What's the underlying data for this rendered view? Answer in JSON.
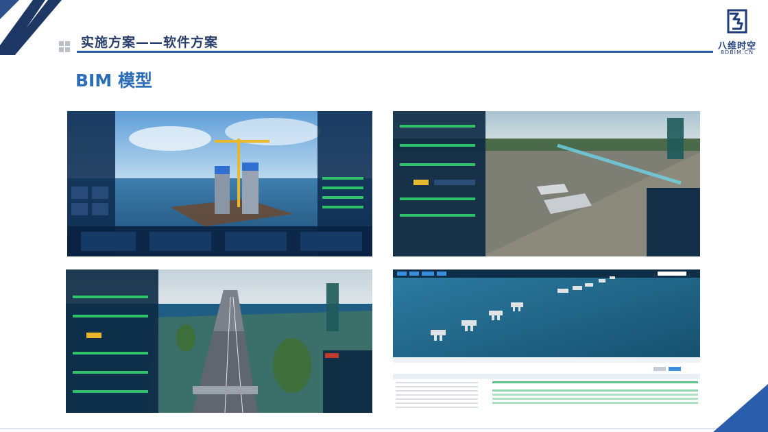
{
  "header": {
    "section_title": "实施方案——软件方案",
    "page_subtitle": "BIM 模型"
  },
  "logo": {
    "name_cn": "八维时空",
    "domain": "8DBIM.CN"
  },
  "colors": {
    "title_blue": "#2c6db8",
    "header_line": "#2a5cac",
    "corner_dark": "#1e3866",
    "logo_navy": "#1f3c78"
  },
  "panels": [
    {
      "id": "bim-screenshot-bridge-pier-construction",
      "icon": "bridge-pier-crane-scene"
    },
    {
      "id": "bim-screenshot-terrain-girder-model",
      "icon": "terrain-girder-scene"
    },
    {
      "id": "bim-screenshot-highway-bridge-model",
      "icon": "highway-bridge-scene"
    },
    {
      "id": "bim-screenshot-water-pier-schedule",
      "icon": "water-pier-gantt-scene"
    }
  ]
}
